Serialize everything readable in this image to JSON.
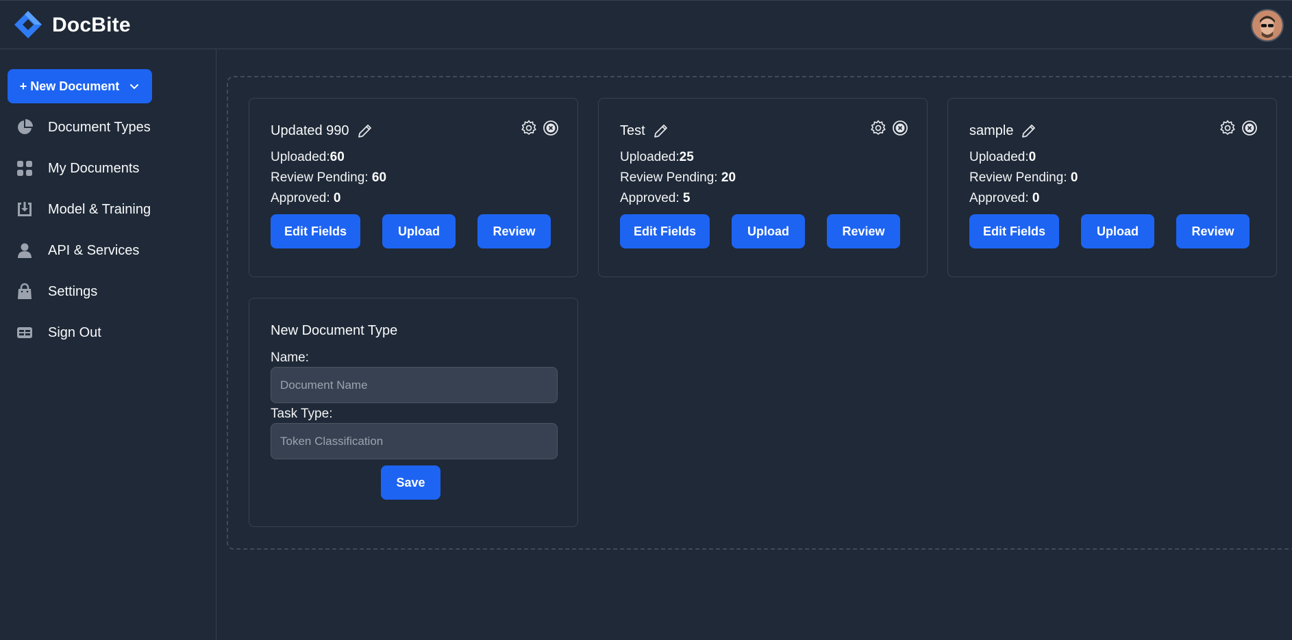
{
  "app": {
    "brand": "DocBite",
    "accent_color": "#1d64f2",
    "background_color": "#1f2937"
  },
  "sidebar": {
    "new_document_label": "+ New Document",
    "items": [
      {
        "label": "Document Types",
        "icon": "pie-chart-icon"
      },
      {
        "label": "My Documents",
        "icon": "grid-icon"
      },
      {
        "label": "Model & Training",
        "icon": "download-box-icon"
      },
      {
        "label": "API & Services",
        "icon": "user-icon"
      },
      {
        "label": "Settings",
        "icon": "bag-icon"
      },
      {
        "label": "Sign Out",
        "icon": "card-icon"
      }
    ]
  },
  "cards": [
    {
      "title": "Updated 990",
      "uploaded_label": "Uploaded:",
      "uploaded_value": "60",
      "review_label": "Review Pending: ",
      "review_value": "60",
      "approved_label": "Approved: ",
      "approved_value": "0",
      "buttons": {
        "edit": "Edit Fields",
        "upload": "Upload",
        "review": "Review"
      }
    },
    {
      "title": "Test",
      "uploaded_label": "Uploaded:",
      "uploaded_value": "25",
      "review_label": "Review Pending: ",
      "review_value": "20",
      "approved_label": "Approved: ",
      "approved_value": "5",
      "buttons": {
        "edit": "Edit Fields",
        "upload": "Upload",
        "review": "Review"
      }
    },
    {
      "title": "sample",
      "uploaded_label": "Uploaded:",
      "uploaded_value": "0",
      "review_label": "Review Pending: ",
      "review_value": "0",
      "approved_label": "Approved: ",
      "approved_value": "0",
      "buttons": {
        "edit": "Edit Fields",
        "upload": "Upload",
        "review": "Review"
      }
    }
  ],
  "new_doc_form": {
    "title": "New Document Type",
    "name_label": "Name:",
    "name_placeholder": "Document Name",
    "task_label": "Task Type:",
    "task_placeholder": "Token Classification",
    "save_label": "Save"
  }
}
